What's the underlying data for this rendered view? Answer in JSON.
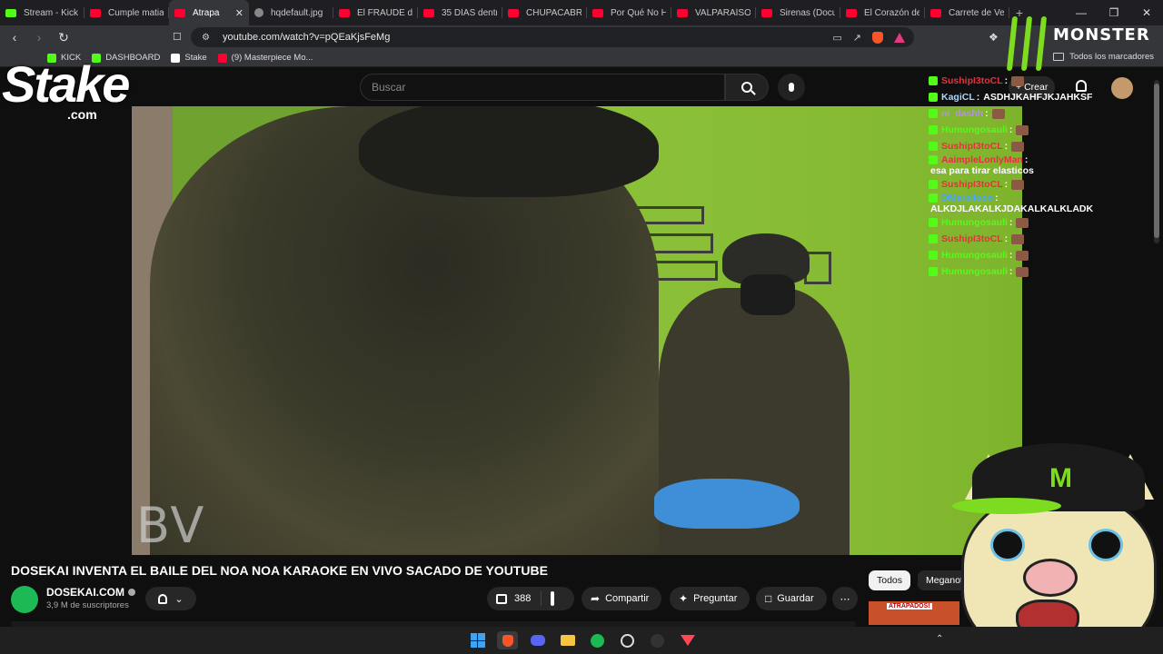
{
  "browser": {
    "tabs": [
      {
        "title": "Stream - Kick",
        "favicon": "kick"
      },
      {
        "title": "Cumple matia",
        "favicon": "yt"
      },
      {
        "title": "Atrapa",
        "favicon": "yt",
        "active": true
      },
      {
        "title": "hqdefault.jpg",
        "favicon": "img"
      },
      {
        "title": "El FRAUDE de",
        "favicon": "yt"
      },
      {
        "title": "35 DÍAS dentr",
        "favicon": "yt"
      },
      {
        "title": "CHUPACABRA",
        "favicon": "yt"
      },
      {
        "title": "Por Qué No H",
        "favicon": "yt"
      },
      {
        "title": "VALPARAÍSO:",
        "favicon": "yt"
      },
      {
        "title": "Sirenas (Docu",
        "favicon": "yt"
      },
      {
        "title": "El Corazón de",
        "favicon": "yt"
      },
      {
        "title": "Carrete de Ve",
        "favicon": "yt"
      }
    ],
    "new_tab": "+",
    "url": "youtube.com/watch?v=pQEaKjsFeMg",
    "bookmarks": [
      {
        "label": "KICK",
        "color": "#53fc18"
      },
      {
        "label": "DASHBOARD",
        "color": "#53fc18"
      },
      {
        "label": "Stake",
        "color": "#ffffff"
      },
      {
        "label": "(9) Masterpiece Mo...",
        "color": "#ff0033"
      }
    ],
    "all_bookmarks": "Todos los marcadores"
  },
  "youtube": {
    "search_placeholder": "Buscar",
    "create_label": "Crear",
    "video_title": "DOSEKAI INVENTA EL BAILE DEL NOA NOA KARAOKE EN VIVO SACADO DE YOUTUBE",
    "channel_name": "DOSEKAI.COM",
    "subscribers": "3,9 M de suscriptores",
    "like_count": "388",
    "share_label": "Compartir",
    "ask_label": "Preguntar",
    "save_label": "Guardar",
    "chips": [
      "Todos",
      "Meganot"
    ],
    "thumb_caption": "ATRAPADOS!",
    "video_overlay_text": "BV"
  },
  "overlays": {
    "stake_word": "Stake",
    "stake_com": ".com",
    "monster_word": "MONSTER"
  },
  "chat": [
    {
      "user": "SushipI3toCL",
      "color": "#e0343c",
      "msg": "",
      "emote": true
    },
    {
      "user": "KagiCL",
      "color": "#a7d9ff",
      "msg": "ASDHJKAHFJKJAHKSF",
      "emote": false
    },
    {
      "user": "ni_dashh",
      "color": "#b98cf0",
      "msg": "",
      "emote": true
    },
    {
      "user": "Humungosauli",
      "color": "#53fc18",
      "msg": "",
      "emote": true
    },
    {
      "user": "SushipI3toCL",
      "color": "#e0343c",
      "msg": "",
      "emote": true
    },
    {
      "user": "AaimpleLonlyMan",
      "color": "#e0343c",
      "msg": "esa para tirar elasticos",
      "emote": false
    },
    {
      "user": "SushipI3toCL",
      "color": "#e0343c",
      "msg": "",
      "emote": true
    },
    {
      "user": "DMarellooo",
      "color": "#4aa3ff",
      "msg": "ALKDJLAKALKJDAKALKALKLADK",
      "emote": false
    },
    {
      "user": "Humungosauli",
      "color": "#53fc18",
      "msg": "",
      "emote": true
    },
    {
      "user": "SushipI3toCL",
      "color": "#e0343c",
      "msg": "",
      "emote": true
    },
    {
      "user": "Humungosauli",
      "color": "#53fc18",
      "msg": "",
      "emote": true
    },
    {
      "user": "Humungosauli",
      "color": "#53fc18",
      "msg": "",
      "emote": true
    }
  ]
}
